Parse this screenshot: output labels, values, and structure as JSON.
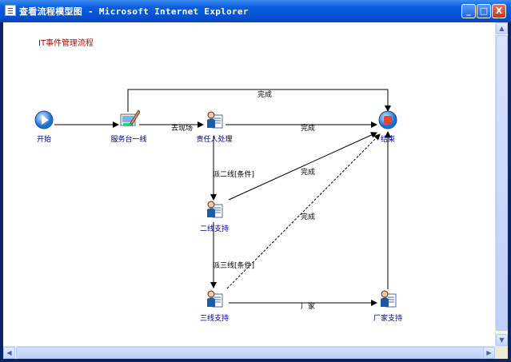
{
  "window": {
    "title": "查看流程模型图 - Microsoft Internet Explorer",
    "minimize_label": "_",
    "maximize_label": "□",
    "close_label": "X"
  },
  "diagram": {
    "title": "IT事件管理流程",
    "nodes": {
      "start": {
        "label": "开始",
        "icon": "play-icon"
      },
      "service_desk": {
        "label": "服务台一线",
        "icon": "service-desk-icon"
      },
      "owner": {
        "label": "责任人处理",
        "icon": "person-icon"
      },
      "end": {
        "label": "结束",
        "icon": "stop-icon"
      },
      "tier2": {
        "label": "二线支持",
        "icon": "person-icon"
      },
      "tier3": {
        "label": "三线支持",
        "icon": "person-icon"
      },
      "vendor": {
        "label": "厂家支持",
        "icon": "person-icon"
      }
    },
    "edges": {
      "desk_to_end": "完成",
      "desk_to_owner": "去现场",
      "owner_to_end": "完成",
      "owner_to_tier2": "派二线[条件]",
      "tier2_to_end": "完成",
      "tier3_to_end": "完成",
      "tier2_to_tier3": "派三线[条件]",
      "tier3_to_vendor": "厂家"
    }
  },
  "colors": {
    "node_label": "#000080",
    "title": "#c00000",
    "titlebar": "#0553d6"
  }
}
